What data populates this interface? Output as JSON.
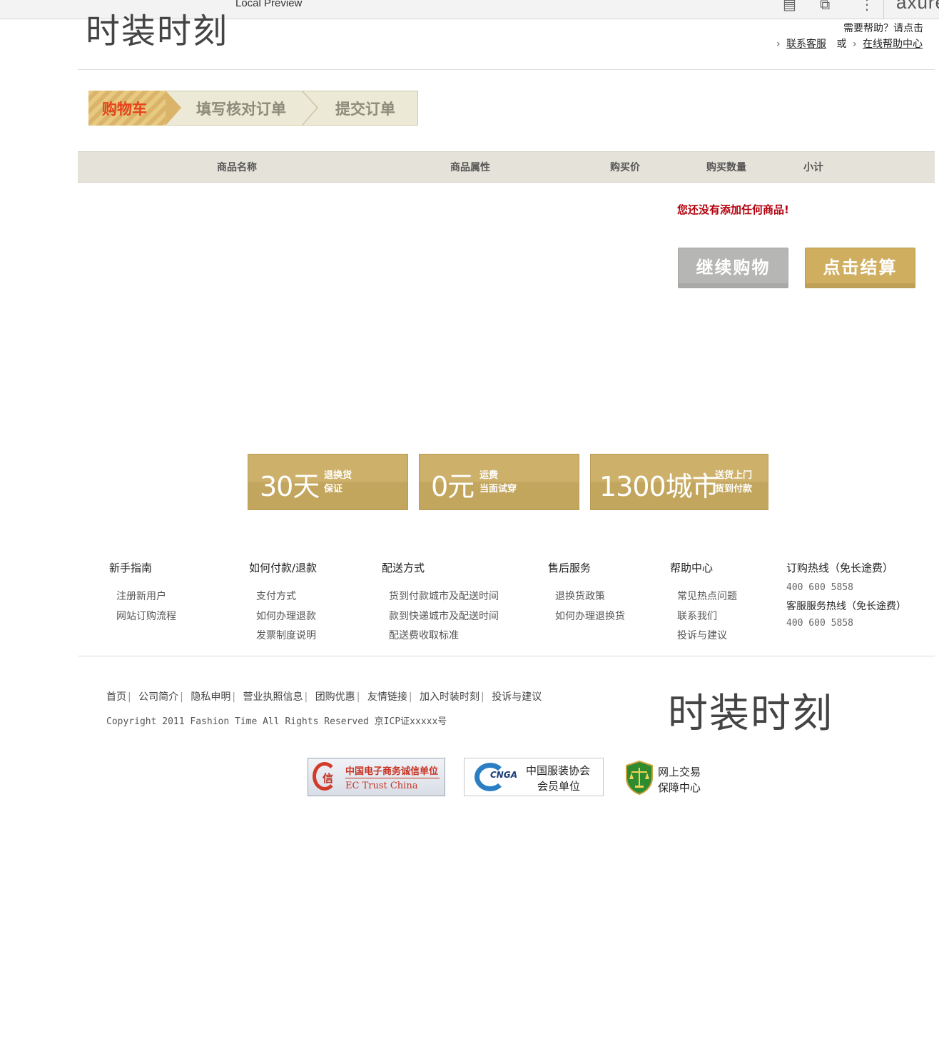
{
  "chrome": {
    "title": "Local Preview",
    "brand": "axure",
    "icons": [
      "page-icon",
      "export-icon",
      "more-vert-icon"
    ]
  },
  "header": {
    "logo": "时装时刻",
    "help_prompt": "需要帮助？请点击",
    "contact_link": "联系客服",
    "or_text": "或",
    "help_center_link": "在线帮助中心"
  },
  "steps": [
    {
      "label": "购物车",
      "active": true
    },
    {
      "label": "填写核对订单",
      "active": false
    },
    {
      "label": "提交订单",
      "active": false
    }
  ],
  "table": {
    "columns": [
      "商品名称",
      "商品属性",
      "购买价",
      "购买数量",
      "小计"
    ],
    "empty_message": "您还没有添加任何商品!"
  },
  "actions": {
    "continue_label": "继续购物",
    "checkout_label": "点击结算"
  },
  "promos": [
    {
      "big": "30天",
      "line1": "退换货",
      "line2": "保证"
    },
    {
      "big": "0元",
      "line1": "运费",
      "line2": "当面试穿"
    },
    {
      "big": "1300城市",
      "line1": "送货上门",
      "line2": "货到付款"
    }
  ],
  "footer": {
    "columns": [
      {
        "title": "新手指南",
        "links": [
          "注册新用户",
          "网站订购流程"
        ]
      },
      {
        "title": "如何付款/退款",
        "links": [
          "支付方式",
          "如何办理退款",
          "发票制度说明"
        ]
      },
      {
        "title": "配送方式",
        "links": [
          "货到付款城市及配送时间",
          "款到快递城市及配送时间",
          "配送费收取标准"
        ]
      },
      {
        "title": "售后服务",
        "links": [
          "退换货政策",
          "如何办理退换货"
        ]
      },
      {
        "title": "帮助中心",
        "links": [
          "常见热点问题",
          "联系我们",
          "投诉与建议"
        ]
      }
    ],
    "hotline": {
      "order_title": "订购热线（免长途费）",
      "order_number": "400 600 5858",
      "service_title": "客服服务热线（免长途费）",
      "service_number": "400 600 5858"
    },
    "bottom_links": [
      "首页",
      "公司简介",
      "隐私申明",
      "营业执照信息",
      "团购优惠",
      "友情链接",
      "加入时装时刻",
      "投诉与建议"
    ],
    "copyright": "Copyright 2011 Fashion Time All Rights Reserved 京ICP证xxxxx号",
    "logo": "时装时刻"
  },
  "badges": {
    "ec": {
      "line1": "中国电子商务诚信单位",
      "line2": "EC Trust China",
      "mark": "信"
    },
    "cnga": {
      "mark": "CNGA",
      "line1": "中国服装协会",
      "line2": "会员单位"
    },
    "trade": {
      "line1": "网上交易",
      "line2": "保障中心"
    }
  }
}
